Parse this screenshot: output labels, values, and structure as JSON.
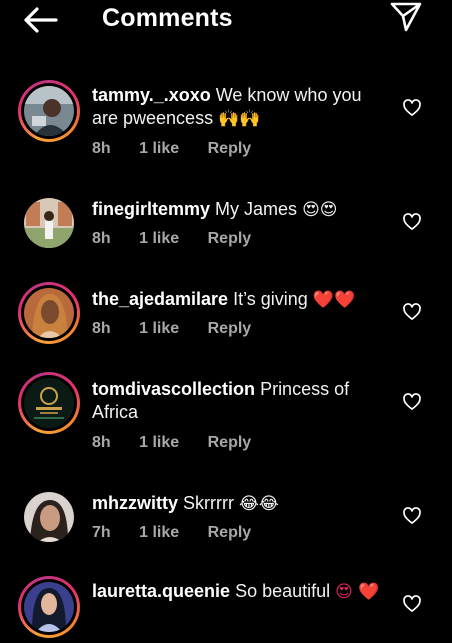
{
  "header": {
    "title": "Comments",
    "back_icon": "arrow-left-icon",
    "send_icon": "paper-plane-icon"
  },
  "colors": {
    "background": "#000000",
    "text": "#ffffff",
    "meta": "#a8a8a8",
    "heart": "#e0245e"
  },
  "comments": [
    {
      "username": "tammy._.xoxo",
      "text": "We know who you are pweencess",
      "emoji": "🙌🙌",
      "time": "8h",
      "likes": "1 like",
      "reply": "Reply",
      "story_ring": true
    },
    {
      "username": "finegirltemmy",
      "text": "My James",
      "emoji": "😍😍",
      "time": "8h",
      "likes": "1 like",
      "reply": "Reply",
      "story_ring": false
    },
    {
      "username": "the_ajedamilare",
      "text": "It’s giving",
      "emoji": "❤️❤️",
      "time": "8h",
      "likes": "1 like",
      "reply": "Reply",
      "story_ring": true
    },
    {
      "username": "tomdivascollection",
      "text": "Princess of Africa",
      "emoji": "",
      "time": "8h",
      "likes": "1 like",
      "reply": "Reply",
      "story_ring": true
    },
    {
      "username": "mhzzwitty",
      "text": "Skrrrrr",
      "emoji": "😂😂",
      "time": "7h",
      "likes": "1 like",
      "reply": "Reply",
      "story_ring": false
    },
    {
      "username": "lauretta.queenie",
      "text": "So beautiful",
      "emoji": "😍 ❤️",
      "story_ring": true
    }
  ]
}
